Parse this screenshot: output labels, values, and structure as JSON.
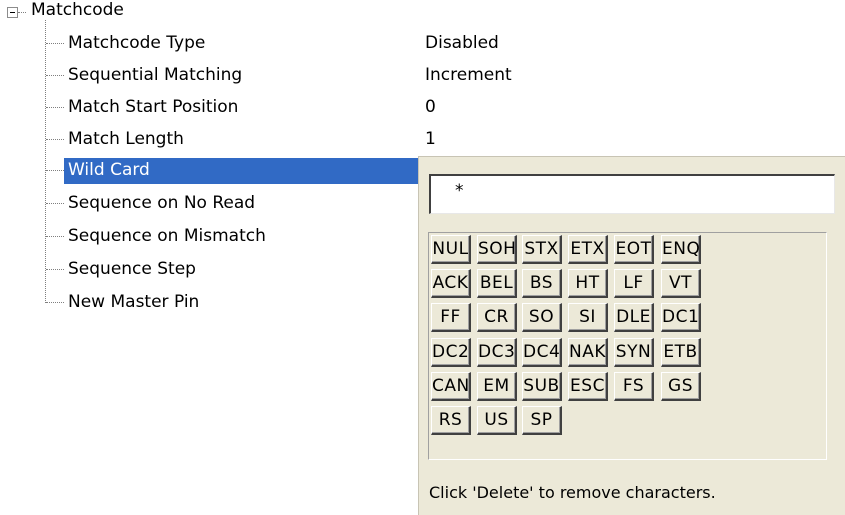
{
  "tree": {
    "root_label": "Matchcode",
    "items": [
      {
        "label": "Matchcode Type",
        "value": "Disabled"
      },
      {
        "label": "Sequential Matching",
        "value": "Increment"
      },
      {
        "label": "Match Start Position",
        "value": "0"
      },
      {
        "label": "Match Length",
        "value": "1"
      },
      {
        "label": "Wild Card",
        "value": ""
      },
      {
        "label": "Sequence on No Read",
        "value": ""
      },
      {
        "label": "Sequence on Mismatch",
        "value": ""
      },
      {
        "label": "Sequence Step",
        "value": ""
      },
      {
        "label": "New Master Pin",
        "value": ""
      }
    ],
    "selected_index": 4
  },
  "popup": {
    "input_value": "*",
    "keys": [
      "NUL",
      "SOH",
      "STX",
      "ETX",
      "EOT",
      "ENQ",
      "ACK",
      "BEL",
      "BS",
      "HT",
      "LF",
      "VT",
      "FF",
      "CR",
      "SO",
      "SI",
      "DLE",
      "DC1",
      "DC2",
      "DC3",
      "DC4",
      "NAK",
      "SYN",
      "ETB",
      "CAN",
      "EM",
      "SUB",
      "ESC",
      "FS",
      "GS",
      "RS",
      "US",
      "SP"
    ],
    "hint": "Click 'Delete' to remove characters."
  },
  "colors": {
    "selection": "#316ac5",
    "panel_bg": "#ece9d8"
  }
}
